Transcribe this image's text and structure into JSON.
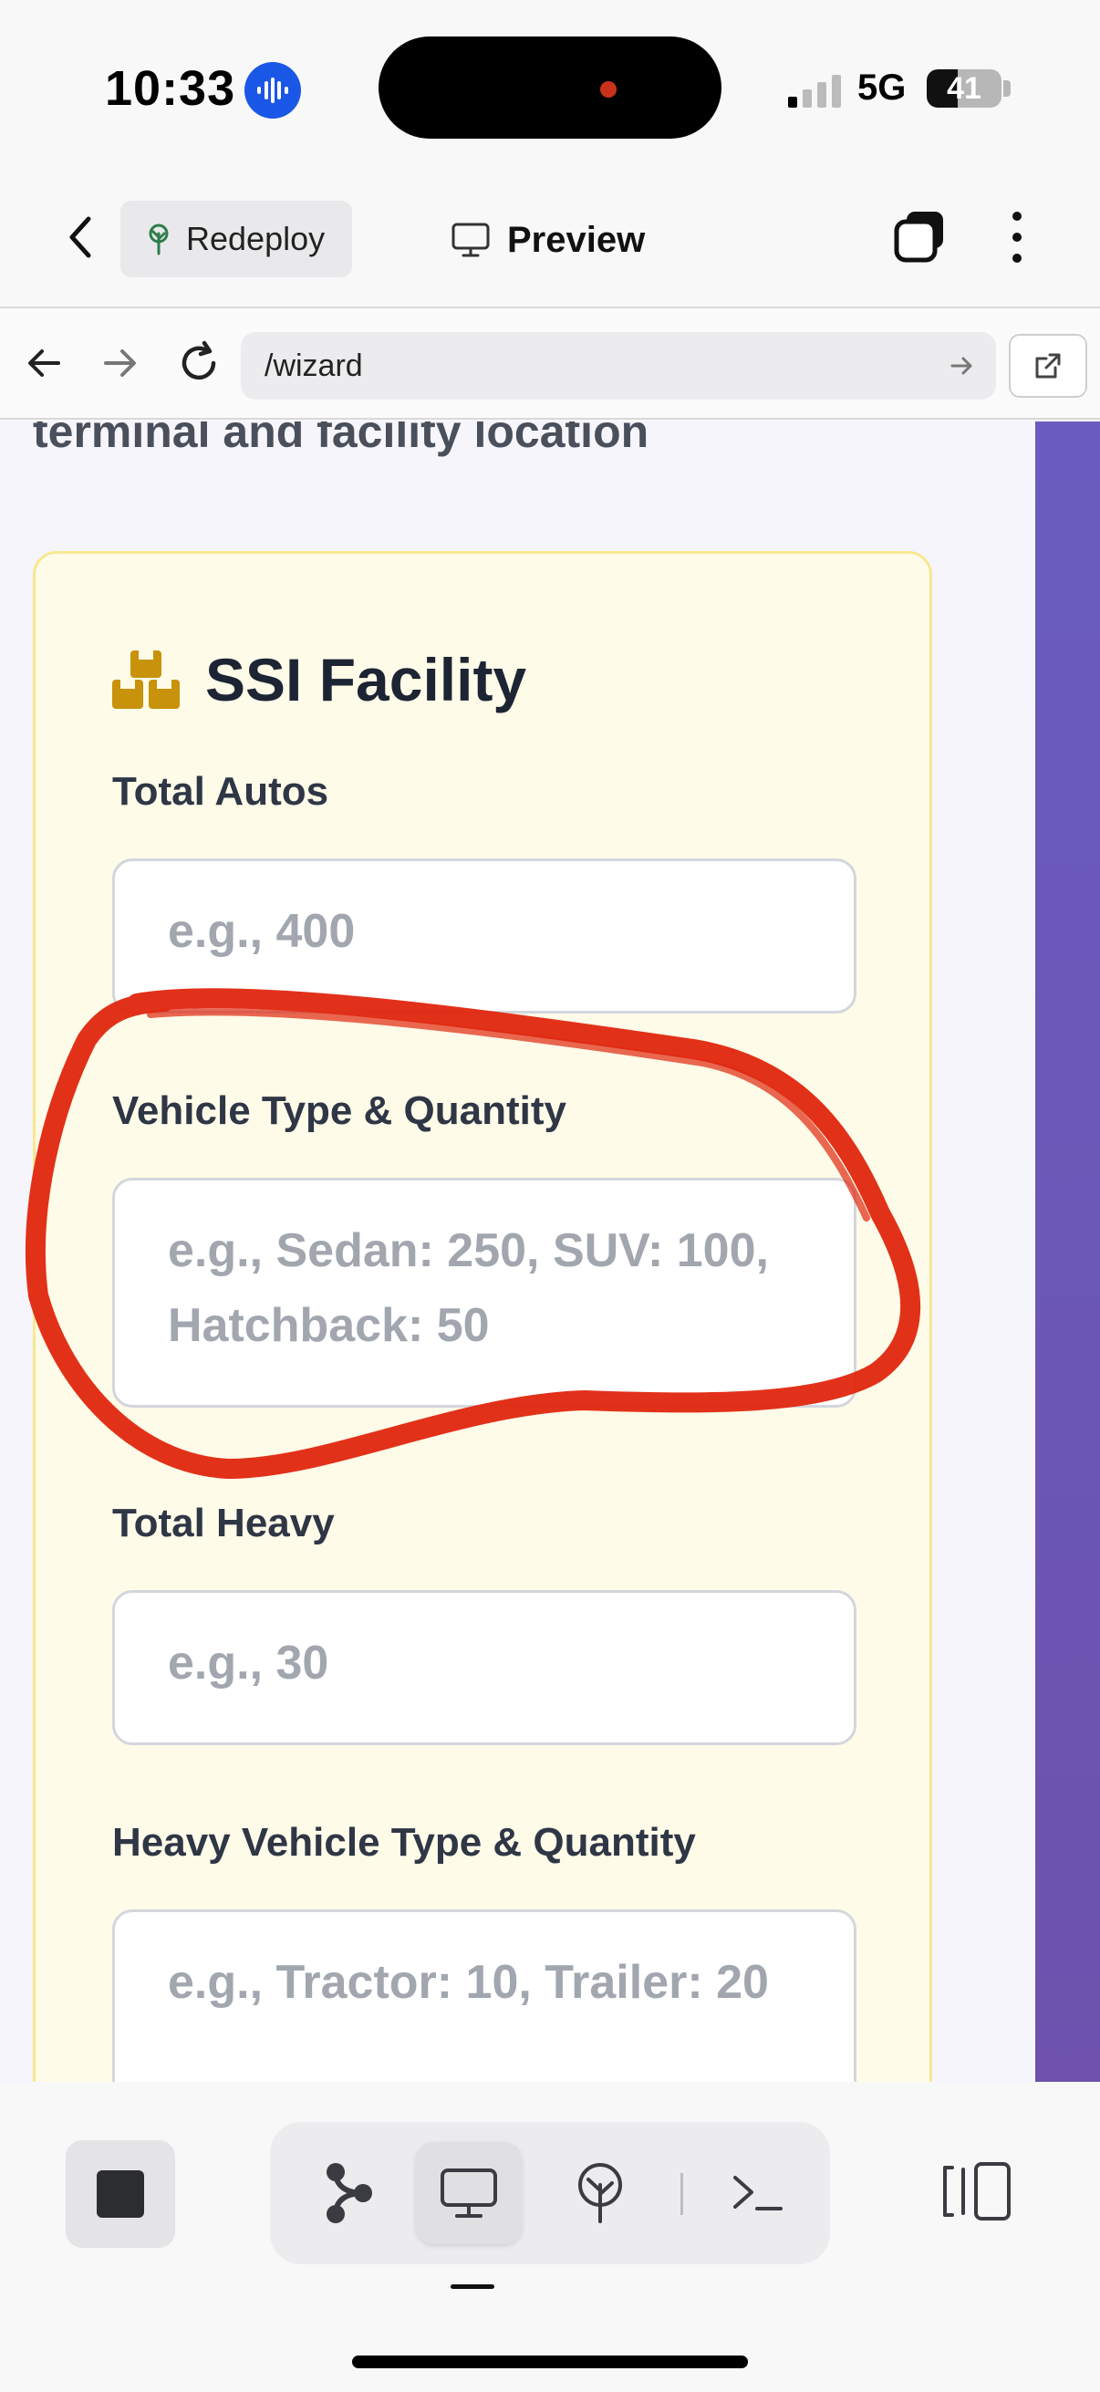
{
  "status_bar": {
    "time": "10:33",
    "network": "5G",
    "battery_level": "41",
    "battery_fraction": 0.41,
    "signal_bars_active": 1,
    "signal_bars_total": 4,
    "voice_icon": "voice-waveform-icon"
  },
  "header": {
    "back_icon": "chevron-left-icon",
    "redeploy_label": "Redeploy",
    "redeploy_icon": "deploy-tree-icon",
    "preview_label": "Preview",
    "preview_icon": "monitor-icon",
    "windows_icon": "stacked-windows-icon",
    "more_icon": "more-vertical-icon"
  },
  "browser": {
    "url": "/wizard",
    "back_icon": "arrow-left-icon",
    "forward_icon": "arrow-right-icon",
    "reload_icon": "reload-icon",
    "go_icon": "arrow-right-icon",
    "external_icon": "open-external-icon"
  },
  "page": {
    "cut_off_text": "terminal and facility location",
    "facility": {
      "title": "SSI Facility",
      "icon": "boxes-icon",
      "fields": [
        {
          "label": "Total Autos",
          "placeholder": "e.g., 400"
        },
        {
          "label": "Vehicle Type & Quantity",
          "placeholder": "e.g., Sedan: 250, SUV: 100, Hatchback: 50"
        },
        {
          "label": "Total Heavy",
          "placeholder": "e.g., 30"
        },
        {
          "label": "Heavy Vehicle Type & Quantity",
          "placeholder": "e.g., Tractor: 10, Trailer: 20"
        }
      ]
    }
  },
  "toolbar": {
    "stop_icon": "stop-icon",
    "tools": [
      "flow-icon",
      "monitor-icon",
      "deploy-tree-icon",
      "terminal-icon"
    ],
    "active_tool": "monitor-icon",
    "panel_icon": "panel-toggle-icon"
  },
  "colors": {
    "accent_purple": "#6a5cc0",
    "card_bg": "#fefbe8",
    "card_border": "#f7e892",
    "icon_gold": "#c9920b",
    "annotation_red": "#e0260e",
    "voice_blue": "#1a57e6"
  }
}
